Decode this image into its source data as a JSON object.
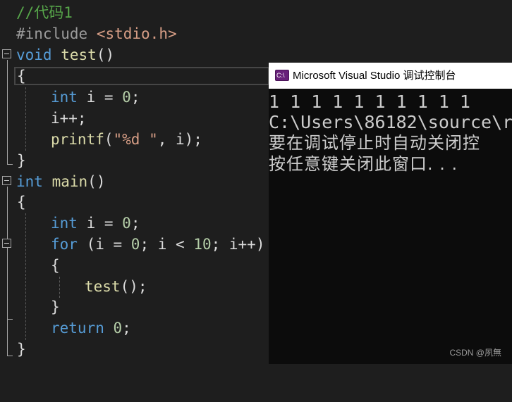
{
  "editor": {
    "lines": {
      "comment": "//代码1",
      "include_directive": "#include",
      "include_file": "<stdio.h>",
      "void_kw": "void",
      "test_fn": "test",
      "parens": "()",
      "open_brace": "{",
      "close_brace": "}",
      "int_kw": "int",
      "decl_i": "i = ",
      "zero": "0",
      "semicolon": ";",
      "incr": "i++;",
      "printf_fn": "printf",
      "printf_open": "(",
      "format_str": "\"%d \"",
      "printf_rest": ", i);",
      "main_fn": "main",
      "for_kw": "for",
      "for_head_a": " (i = ",
      "for_head_b": "; i < ",
      "ten": "10",
      "for_head_c": "; i++)",
      "test_call": "test",
      "call_rest": "();",
      "return_kw": "return",
      "return_rest": ";"
    }
  },
  "console_window": {
    "title": "Microsoft Visual Studio 调试控制台",
    "icon_text": "C:\\",
    "output_lines": [
      "1 1 1 1 1 1 1 1 1 1",
      "C:\\Users\\86182\\source\\r",
      "要在调试停止时自动关闭控",
      "按任意键关闭此窗口. . ."
    ]
  },
  "watermark": "CSDN @夙無",
  "colors": {
    "comment": "#57a64a",
    "keyword": "#569cd6",
    "string": "#d69d85",
    "function": "#dcdcaa",
    "number": "#b5cea8",
    "console_bg": "#0c0c0c",
    "editor_bg": "#1e1e1e"
  }
}
